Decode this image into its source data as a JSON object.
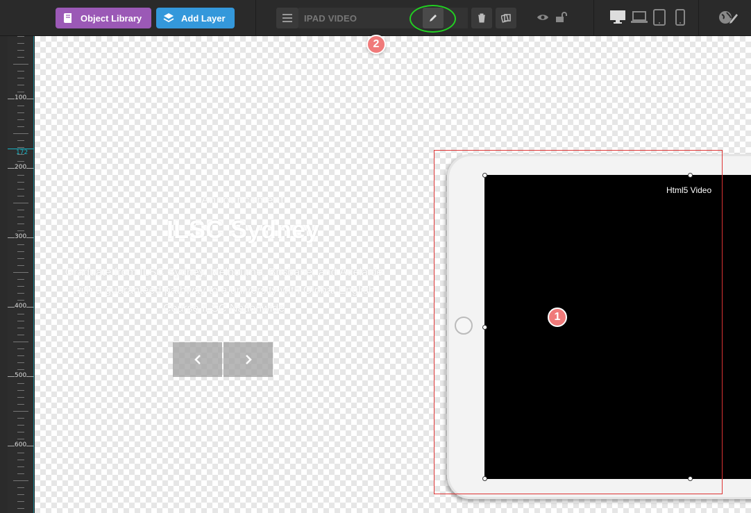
{
  "toolbar": {
    "object_library_label": "Object Library",
    "add_layer_label": "Add Layer",
    "layer_name": "IPAD VIDEO",
    "colors": {
      "library": "#9b59b6",
      "add_layer": "#3498db",
      "highlight": "#22d022"
    }
  },
  "annotations": {
    "badge_1": "1",
    "badge_2": "2"
  },
  "ruler": {
    "labels": [
      "100",
      "200",
      "300",
      "400",
      "500",
      "600"
    ],
    "marker": "172"
  },
  "slide": {
    "subtitle": "Announcement",
    "title": "ILSC Sydney",
    "body": "Graduate from ILSC Sydney, Melbourne, Brisbane, and Adelaide with a guaranteed pathway to a university with Global English Course ILSC Nationwide"
  },
  "video": {
    "label": "Html5 Video"
  }
}
